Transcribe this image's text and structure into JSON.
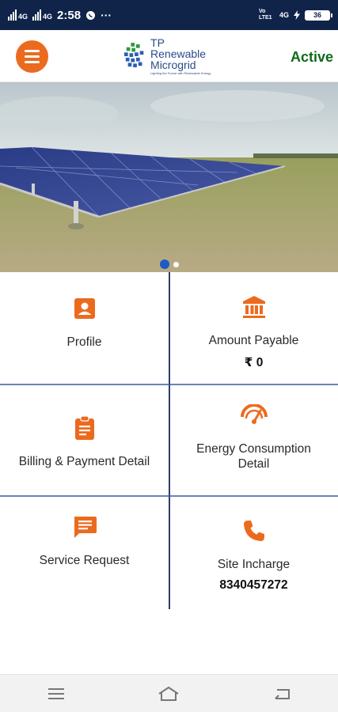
{
  "status_bar": {
    "time": "2:58",
    "sim1_label": "4G",
    "sim2_label": "4G",
    "right_network": "Vo LTE1",
    "right_signal": "4G",
    "battery": "36"
  },
  "header": {
    "logo_line1": "TP Renewable",
    "logo_line2": "Microgrid",
    "logo_tagline": "Lighting the Future with Renewable Energy",
    "status": "Active"
  },
  "banner": {
    "slide_count": 2,
    "active_slide": 1
  },
  "tiles": {
    "profile": {
      "label": "Profile",
      "icon": "account-box-icon"
    },
    "amount_payable": {
      "label": "Amount Payable",
      "value": "₹ 0",
      "icon": "bank-icon"
    },
    "billing": {
      "label": "Billing & Payment Detail",
      "icon": "clipboard-icon"
    },
    "energy": {
      "label": "Energy Consumption Detail",
      "icon": "gauge-icon"
    },
    "service": {
      "label": "Service Request",
      "icon": "chat-message-icon"
    },
    "site_incharge": {
      "label": "Site Incharge",
      "value": "8340457272",
      "icon": "phone-icon"
    }
  },
  "colors": {
    "accent": "#ec6a1e",
    "status_bar": "#10244a",
    "active_green": "#0f6b1a",
    "divider": "#2c3f6b"
  }
}
